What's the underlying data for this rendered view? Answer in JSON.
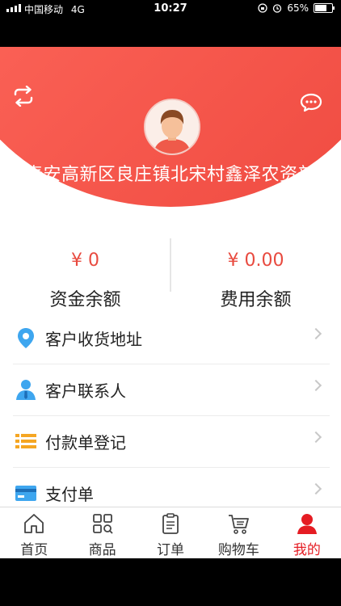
{
  "status_bar": {
    "carrier": "中国移动",
    "network": "4G",
    "time": "10:27",
    "battery": "65%"
  },
  "header": {
    "shop_name": "泰安高新区良庄镇北宋村鑫泽农资部",
    "left_icon": "switch-icon",
    "right_icon": "message-icon",
    "accent_color": "#ef4a40"
  },
  "balances": [
    {
      "amount": "¥ 0",
      "label": "资金余额"
    },
    {
      "amount": "¥ 0.00",
      "label": "费用余额"
    }
  ],
  "menu": {
    "items": [
      {
        "label": "客户收货地址",
        "icon": "location-icon"
      },
      {
        "label": "客户联系人",
        "icon": "contact-icon"
      },
      {
        "label": "付款单登记",
        "icon": "list-icon"
      },
      {
        "label": "支付单",
        "icon": "card-icon"
      }
    ]
  },
  "tabbar": {
    "active_color": "#e51c23",
    "tabs": [
      {
        "label": "首页",
        "icon": "home-icon"
      },
      {
        "label": "商品",
        "icon": "grid-icon"
      },
      {
        "label": "订单",
        "icon": "clipboard-icon"
      },
      {
        "label": "购物车",
        "icon": "cart-icon"
      },
      {
        "label": "我的",
        "icon": "user-icon",
        "active": true
      }
    ]
  }
}
